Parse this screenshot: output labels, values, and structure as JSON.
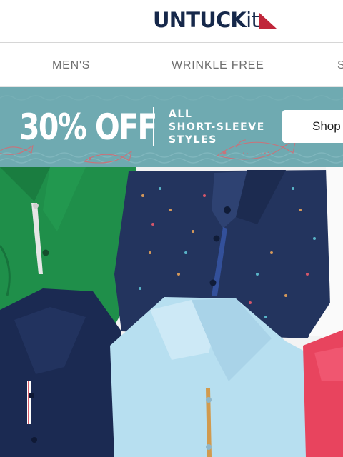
{
  "brand": {
    "name_main": "UNTUCK",
    "name_suffix": "it",
    "primary_color": "#16284a",
    "accent_color": "#c0263a"
  },
  "nav": {
    "items": [
      {
        "label": "MEN'S"
      },
      {
        "label": "WRINKLE FREE"
      },
      {
        "label": "S"
      }
    ]
  },
  "promo": {
    "headline": "30% OFF",
    "line1": "ALL",
    "line2": "SHORT-SLEEVE",
    "line3": "STYLES",
    "cta_label": "Shop",
    "background_color": "#6faab1"
  },
  "hero": {
    "image_description_icon": "polo-shirts-image",
    "shirt_colors": [
      "#1f8f4a",
      "#1b2a52",
      "#b7dff0",
      "#e8445e",
      "#f2f2f2"
    ]
  }
}
